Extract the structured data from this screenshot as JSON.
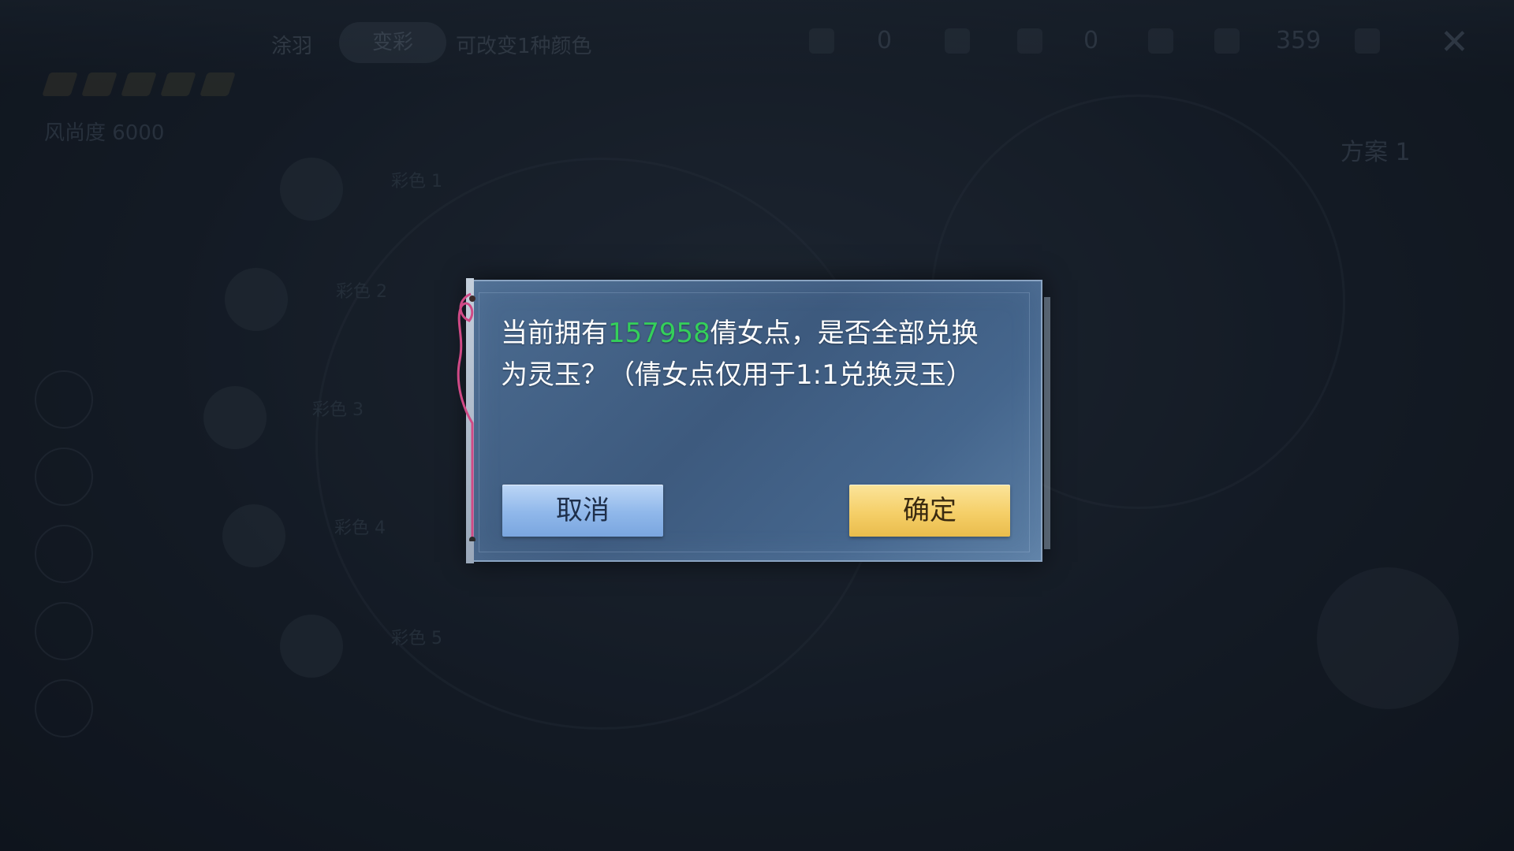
{
  "background": {
    "tabs": [
      "涂羽",
      "变彩",
      "可改变1种颜色"
    ],
    "resources": [
      "0",
      "0",
      "359"
    ],
    "score": "风尚度 6000",
    "plan": "方案 1",
    "slots": [
      "彩色 1",
      "彩色 2",
      "彩色 3",
      "彩色 4",
      "彩色 5"
    ]
  },
  "dialog": {
    "message_before": "当前拥有",
    "amount": "157958",
    "message_after": "倩女点，是否全部兑换为灵玉？（倩女点仅用于1:1兑换灵玉）",
    "cancel_label": "取消",
    "confirm_label": "确定"
  },
  "icons": {
    "close": "close-icon",
    "ribbon": "ribbon-decoration"
  },
  "colors": {
    "highlight": "#34d05a",
    "cancel_button": "#8fb7ea",
    "confirm_button": "#f5cf68"
  }
}
